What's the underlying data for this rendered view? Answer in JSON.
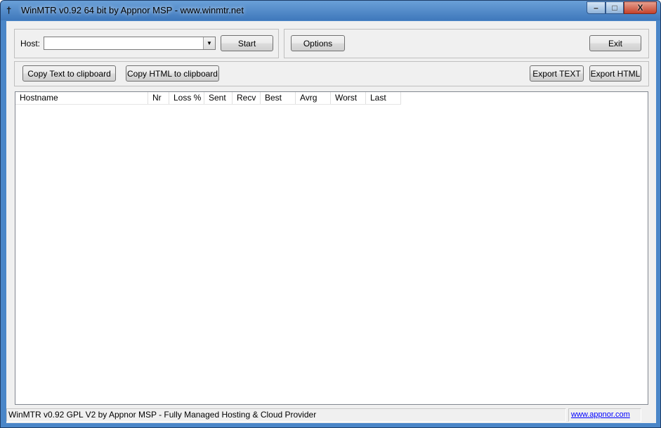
{
  "window": {
    "title": "WinMTR v0.92 64 bit by Appnor MSP - www.winmtr.net",
    "app_icon": "winmtr-tower-icon",
    "controls": {
      "minimize": "–",
      "maximize": "□",
      "close": "X"
    }
  },
  "host_group": {
    "host_label": "Host:",
    "host_value": "",
    "start_label": "Start"
  },
  "options_group": {
    "options_label": "Options",
    "exit_label": "Exit"
  },
  "export_group": {
    "copy_text_label": "Copy Text to clipboard",
    "copy_html_label": "Copy HTML to clipboard",
    "export_text_label": "Export TEXT",
    "export_html_label": "Export HTML"
  },
  "results": {
    "columns": [
      "Hostname",
      "Nr",
      "Loss %",
      "Sent",
      "Recv",
      "Best",
      "Avrg",
      "Worst",
      "Last"
    ],
    "rows": []
  },
  "status": {
    "text": "WinMTR v0.92 GPL V2 by Appnor MSP - Fully Managed Hosting & Cloud Provider",
    "link": "www.appnor.com"
  }
}
